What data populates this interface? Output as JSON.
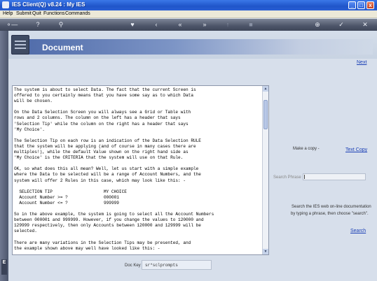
{
  "window": {
    "title": "IES Client(Q) v8.24 : My IES",
    "min_label": "_",
    "max_label": "□",
    "close_label": "x"
  },
  "menu": {
    "items": [
      {
        "label": "Help"
      },
      {
        "label": "Submit"
      },
      {
        "label": "Quit"
      },
      {
        "label": "Functions"
      },
      {
        "label": "Commands"
      }
    ]
  },
  "toolbar": {
    "icons": [
      "key-icon",
      "help-icon",
      "search-icon",
      "heart-icon",
      "back-icon",
      "rewind-icon",
      "forward-icon",
      "up-icon",
      "stop-icon",
      "add-icon",
      "check-icon",
      "close-icon"
    ]
  },
  "left_strip": {
    "tab_label": "E"
  },
  "header": {
    "title": "Document"
  },
  "nav": {
    "next_label": "Next"
  },
  "document": {
    "text": "The system is about to select Data. The fact that the current Screen is\noffered to you certainly means that you have some say as to which Data\nwill be chosen.\n\nOn the Data Selection Screen you will always see a Grid or Table with\nrows and 2 columns. The column on the left has a header that says\n'Selection Tip' while the column on the right has a header that says\n'My Choice'.\n\nThe Selection Tip on each row is an indication of the Data Selection RULE\nthat the system will be applying (and of course in many cases there are\nmultiples!), while the default Value shown on the right hand side as\n'My Choice' is the CRITERIA that the system will use on that Rule.\n\nOK, so what does this all mean? Well, let us start with a simple example\nwhere the Data to be selected will be a range of Account Numbers, and the\nsystem will offer 2 Rules in this case, which may look like this: -\n\n  SELECTION TIP                    MY CHOICE\n  Account Number >= ?              000001\n  Account Number <= ?              999999\n\nSo in the above example, the system is going to select all the Account Numbers\nbetween 000001 and 999999. However, if you change the values to 120000 and\n129999 respectively, then only Accounts between 120000 and 129999 will be\nselected.\n\nThere are many variations in the Selection Tips may be presented, and\nthe example shown above may well have looked like this: -"
  },
  "side": {
    "make_copy_label": "Make a copy -",
    "text_copy_label": "Text Copy",
    "search_phrase_label": "Search Phrase",
    "search_phrase_value": "",
    "search_help_line1": "Search the IES web on-line documentation",
    "search_help_line2": "by typing a phrase, then choose \"search\".",
    "search_label": "Search"
  },
  "footer": {
    "doc_key_label": "Doc Key",
    "doc_key_value": "sr*sclprompts"
  }
}
